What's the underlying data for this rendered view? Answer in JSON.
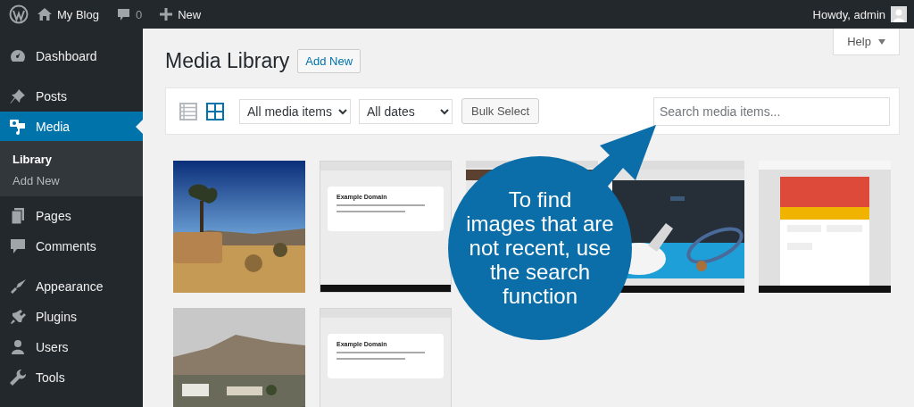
{
  "admin_bar": {
    "site_name": "My Blog",
    "comments_count": "0",
    "new_label": "New",
    "greeting": "Howdy, admin"
  },
  "sidebar": {
    "items": [
      {
        "label": "Dashboard",
        "selected": false
      },
      {
        "label": "Posts",
        "selected": false
      },
      {
        "label": "Media",
        "selected": true,
        "children": [
          {
            "label": "Library",
            "selected": true
          },
          {
            "label": "Add New",
            "selected": false
          }
        ]
      },
      {
        "label": "Pages",
        "selected": false
      },
      {
        "label": "Comments",
        "selected": false
      },
      {
        "label": "Appearance",
        "selected": false
      },
      {
        "label": "Plugins",
        "selected": false
      },
      {
        "label": "Users",
        "selected": false
      },
      {
        "label": "Tools",
        "selected": false
      }
    ]
  },
  "help_tab": {
    "label": "Help"
  },
  "page_title": "Media Library",
  "add_new_button": "Add New",
  "toolbar": {
    "view_modes": [
      {
        "selected": false
      },
      {
        "selected": true
      }
    ],
    "filters": [
      {
        "value": "All media items"
      },
      {
        "value": "All dates"
      }
    ],
    "bulk_select_button": "Bulk Select",
    "search": {
      "placeholder": "Search media items..."
    }
  },
  "media_items": [
    {
      "kind": "picture"
    },
    {
      "kind": "screenshot",
      "heading": "Example Domain"
    },
    {
      "kind": "picture"
    },
    {
      "kind": "picture"
    },
    {
      "kind": "picture"
    },
    {
      "kind": "picture"
    },
    {
      "kind": "screenshot",
      "heading": "Example Domain"
    }
  ],
  "callout": {
    "lines": [
      "To find",
      "images that are",
      "not recent, use",
      "the search",
      "function"
    ]
  }
}
